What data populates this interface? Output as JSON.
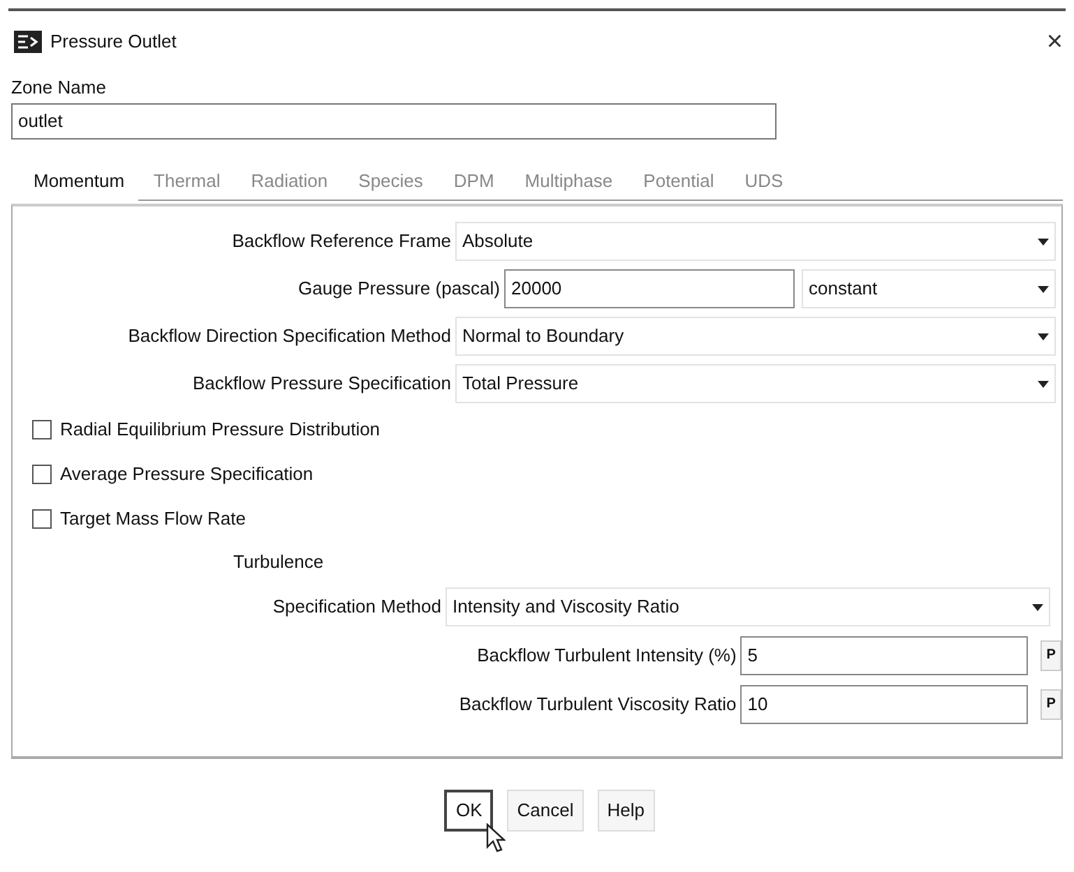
{
  "window": {
    "title": "Pressure Outlet",
    "close": "×"
  },
  "zone": {
    "label": "Zone Name",
    "value": "outlet"
  },
  "tabs": [
    {
      "label": "Momentum",
      "selected": true
    },
    {
      "label": "Thermal",
      "selected": false
    },
    {
      "label": "Radiation",
      "selected": false
    },
    {
      "label": "Species",
      "selected": false
    },
    {
      "label": "DPM",
      "selected": false
    },
    {
      "label": "Multiphase",
      "selected": false
    },
    {
      "label": "Potential",
      "selected": false
    },
    {
      "label": "UDS",
      "selected": false
    }
  ],
  "rows": [
    {
      "kind": "dropdown",
      "label": "Backflow Reference Frame",
      "value": "Absolute"
    },
    {
      "kind": "value_dropdown",
      "label": "Gauge Pressure (pascal)",
      "value": "20000",
      "option": "constant"
    },
    {
      "kind": "dropdown",
      "label": "Backflow Direction Specification Method",
      "value": "Normal to Boundary"
    },
    {
      "kind": "dropdown",
      "label": "Backflow Pressure Specification",
      "value": "Total Pressure"
    },
    {
      "kind": "checkbox",
      "label": "Radial Equilibrium Pressure Distribution",
      "checked": false
    },
    {
      "kind": "checkbox",
      "label": "Average Pressure Specification",
      "checked": false
    },
    {
      "kind": "checkbox",
      "label": "Target Mass Flow Rate",
      "checked": false
    },
    {
      "kind": "heading",
      "label": "Turbulence"
    },
    {
      "kind": "method",
      "label": "Specification Method",
      "value": "Intensity and Viscosity Ratio"
    },
    {
      "kind": "param",
      "label": "Backflow Turbulent Intensity (%)",
      "value": "5",
      "button": "P"
    },
    {
      "kind": "param",
      "label": "Backflow Turbulent Viscosity Ratio",
      "value": "10",
      "button": "P"
    }
  ],
  "buttons": [
    {
      "label": "OK",
      "selected": true
    },
    {
      "label": "Cancel",
      "selected": false
    },
    {
      "label": "Help",
      "selected": false
    }
  ]
}
